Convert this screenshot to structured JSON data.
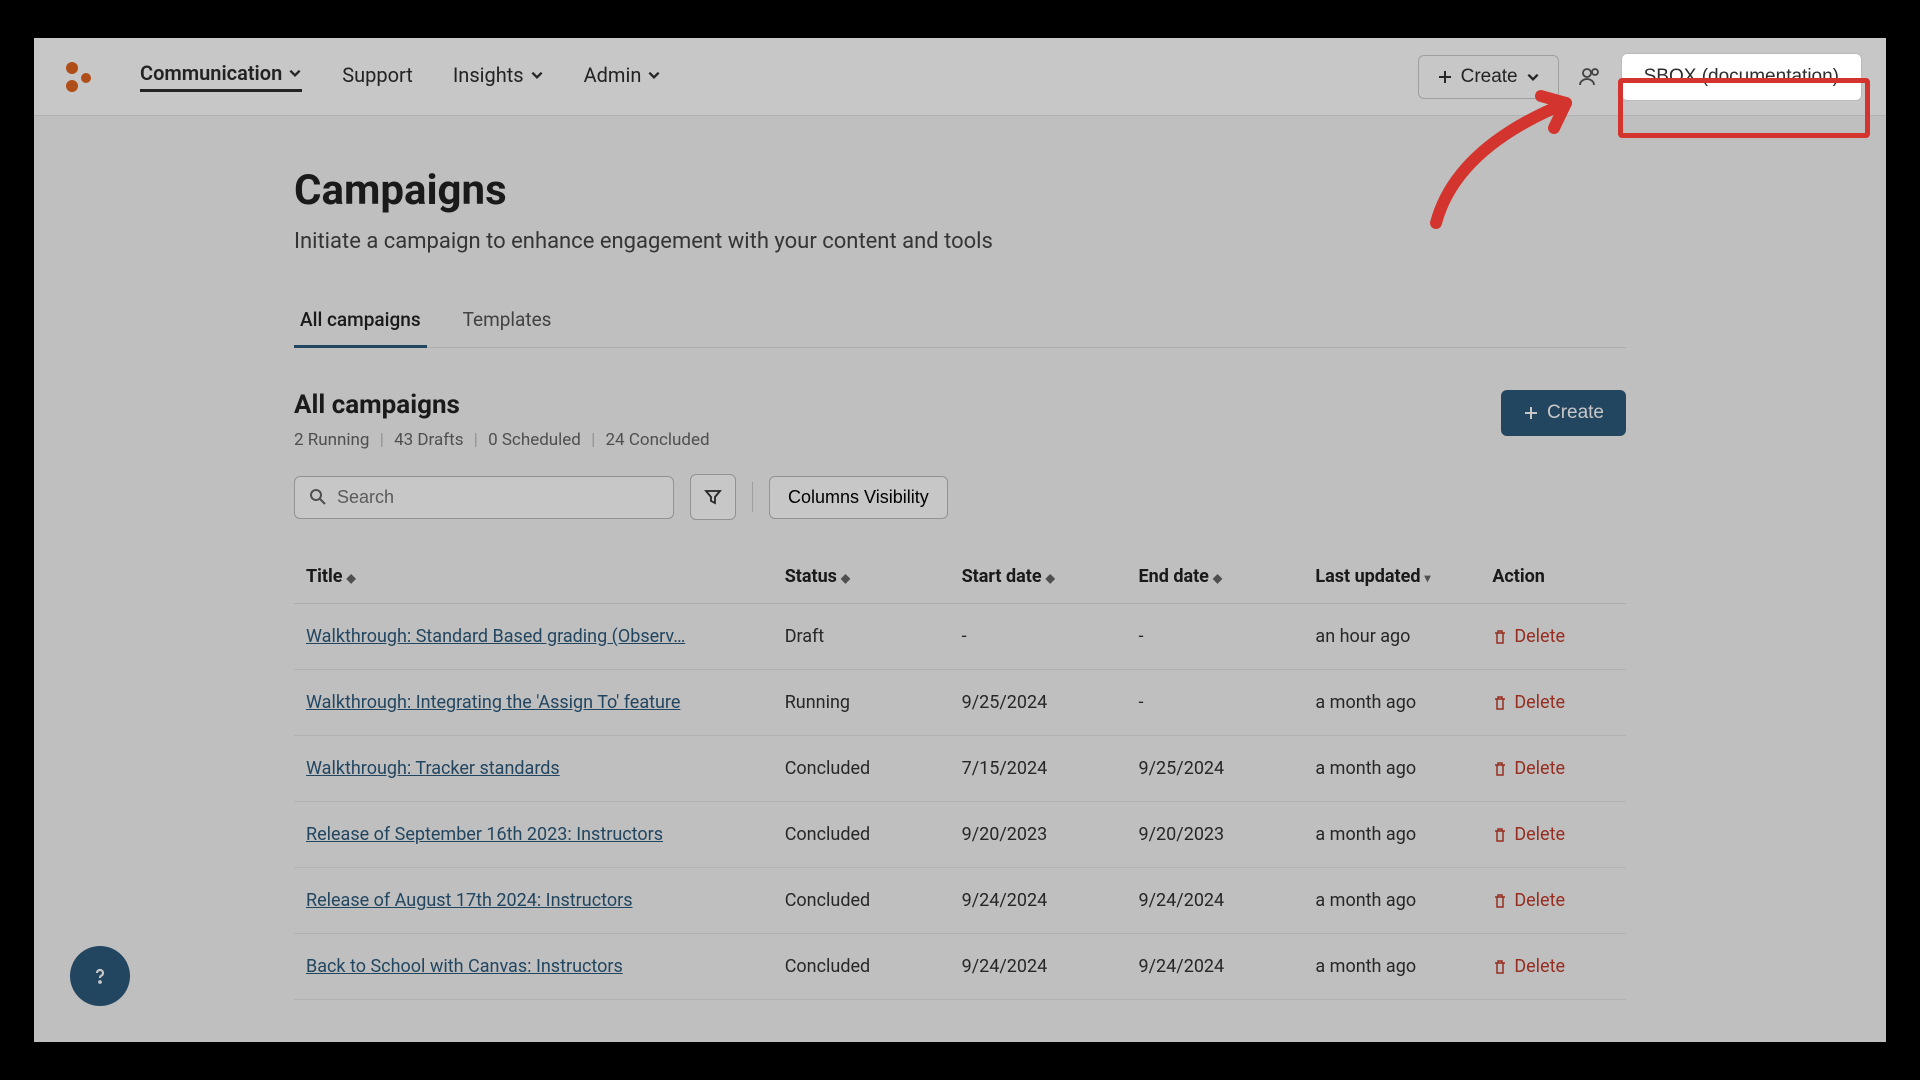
{
  "nav": {
    "items": [
      {
        "label": "Communication",
        "dropdown": true,
        "active": true
      },
      {
        "label": "Support",
        "dropdown": false,
        "active": false
      },
      {
        "label": "Insights",
        "dropdown": true,
        "active": false
      },
      {
        "label": "Admin",
        "dropdown": true,
        "active": false
      }
    ],
    "create_label": "Create",
    "sbox_label": "SBOX (documentation)"
  },
  "page": {
    "title": "Campaigns",
    "subtitle": "Initiate a campaign to enhance engagement with your content and tools"
  },
  "tabs": [
    {
      "label": "All campaigns",
      "active": true
    },
    {
      "label": "Templates",
      "active": false
    }
  ],
  "section": {
    "title": "All campaigns",
    "summary": {
      "running": "2 Running",
      "drafts": "43 Drafts",
      "scheduled": "0 Scheduled",
      "concluded": "24 Concluded"
    },
    "create_label": "Create"
  },
  "search": {
    "placeholder": "Search"
  },
  "columns_visibility_label": "Columns Visibility",
  "table": {
    "headers": {
      "title": "Title",
      "status": "Status",
      "start_date": "Start date",
      "end_date": "End date",
      "last_updated": "Last updated",
      "action": "Action"
    },
    "rows": [
      {
        "title": "Walkthrough: Standard Based grading (Observ…",
        "status": "Draft",
        "start": "-",
        "end": "-",
        "updated": "an hour ago"
      },
      {
        "title": "Walkthrough: Integrating the 'Assign To' feature",
        "status": "Running",
        "start": "9/25/2024",
        "end": "-",
        "updated": "a month ago"
      },
      {
        "title": "Walkthrough: Tracker standards",
        "status": "Concluded",
        "start": "7/15/2024",
        "end": "9/25/2024",
        "updated": "a month ago"
      },
      {
        "title": "Release of September 16th 2023: Instructors",
        "status": "Concluded",
        "start": "9/20/2023",
        "end": "9/20/2023",
        "updated": "a month ago"
      },
      {
        "title": "Release of August 17th 2024: Instructors",
        "status": "Concluded",
        "start": "9/24/2024",
        "end": "9/24/2024",
        "updated": "a month ago"
      },
      {
        "title": "Back to School with Canvas: Instructors",
        "status": "Concluded",
        "start": "9/24/2024",
        "end": "9/24/2024",
        "updated": "a month ago"
      }
    ],
    "delete_label": "Delete"
  },
  "annotation": {
    "highlight_color": "#D4342E"
  }
}
